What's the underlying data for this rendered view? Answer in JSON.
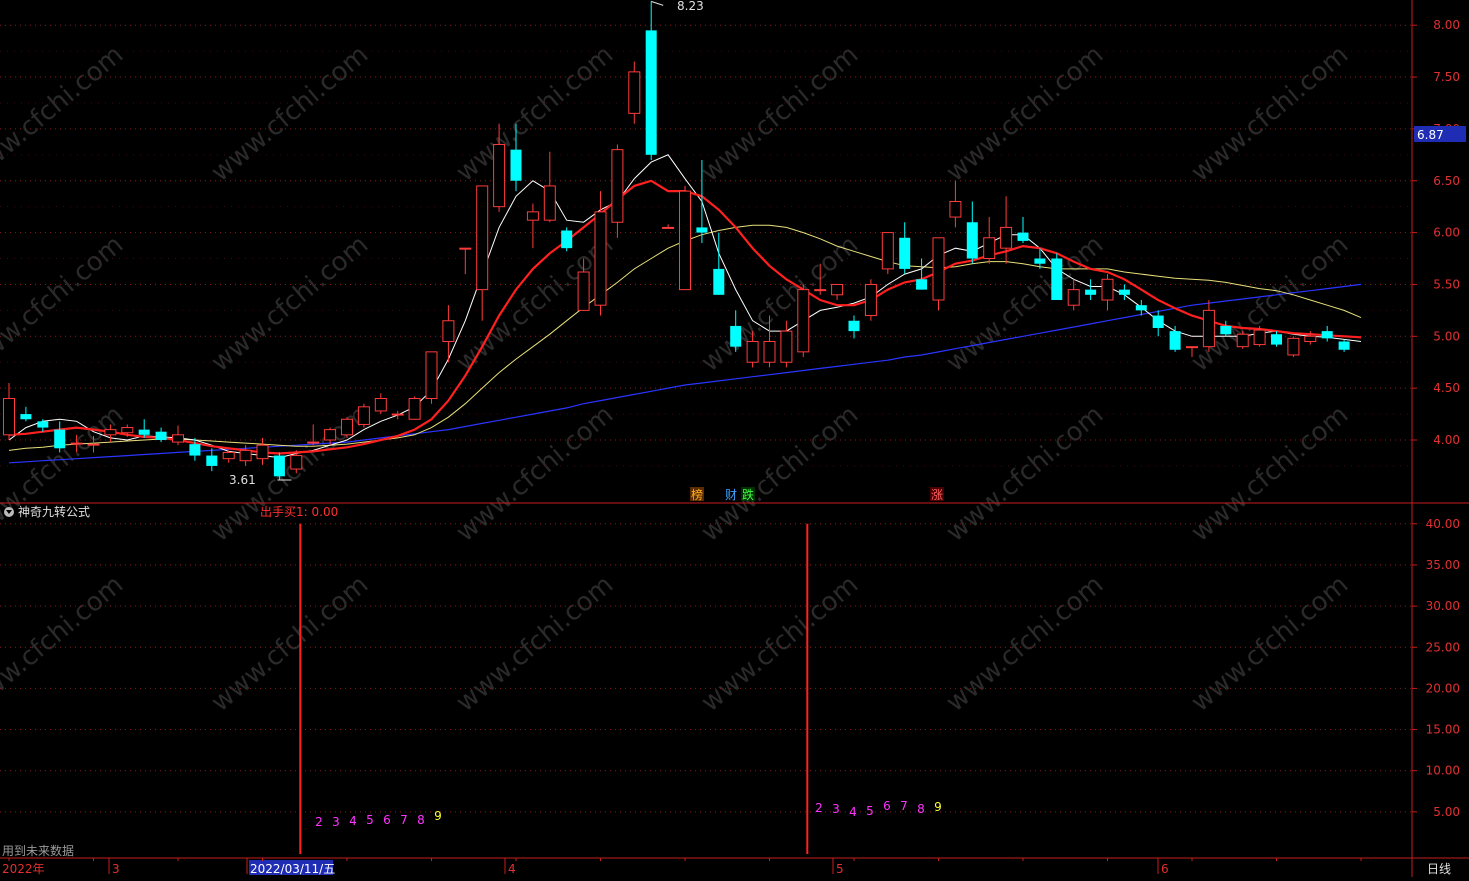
{
  "colors": {
    "background": "#000000",
    "up": "#ff3b3b",
    "down": "#00ffff",
    "grid": "#8b1a1a",
    "axis": "#c81e1e",
    "ma5": "#ffffff",
    "ma10": "#ff2020",
    "ma20": "#e8e07a",
    "ma60": "#2a35ff",
    "count": "#ff33ff",
    "count9": "#ffff33",
    "signal": "#ff2020",
    "last_price_bg": "#1e2db4"
  },
  "main_panel": {
    "y_ticks": [
      "8.00",
      "7.50",
      "7.00",
      "6.50",
      "6.00",
      "5.50",
      "5.00",
      "4.50",
      "4.00"
    ],
    "last_price": "6.87",
    "high_label": "8.23",
    "low_label": "3.61",
    "markers": [
      {
        "text": "榜",
        "color": "#ffb020",
        "bg": "#5a2a00"
      },
      {
        "text": "财",
        "color": "#40a0ff",
        "bg": "#000000"
      },
      {
        "text": "跌",
        "color": "#40ff40",
        "bg": "#003000"
      },
      {
        "text": "涨",
        "color": "#ff6060",
        "bg": "#4a0000"
      }
    ]
  },
  "indicator_panel": {
    "title": "神奇九转公式",
    "readout": "出手买1: 0.00",
    "y_ticks": [
      "40.00",
      "35.00",
      "30.00",
      "25.00",
      "20.00",
      "15.00",
      "10.00",
      "5.00"
    ],
    "footer_note": "用到未来数据",
    "count_sequences": [
      [
        "2",
        "3",
        "4",
        "5",
        "6",
        "7",
        "8",
        "9"
      ],
      [
        "2",
        "3",
        "4",
        "5",
        "6",
        "7",
        "8",
        "9"
      ]
    ]
  },
  "x_axis": {
    "labels": [
      "2022年",
      "3",
      "2022/03/11/五",
      "4",
      "5",
      "6"
    ],
    "period": "日线"
  },
  "watermark": "www.cfchi.com",
  "chart_data": {
    "type": "candlestick",
    "title": "",
    "ylim": [
      3.5,
      8.3
    ],
    "candles": [
      {
        "o": 4.05,
        "h": 4.55,
        "l": 4.0,
        "c": 4.4
      },
      {
        "o": 4.25,
        "h": 4.32,
        "l": 4.18,
        "c": 4.2
      },
      {
        "o": 4.18,
        "h": 4.2,
        "l": 4.08,
        "c": 4.12
      },
      {
        "o": 4.1,
        "h": 4.18,
        "l": 3.88,
        "c": 3.92
      },
      {
        "o": 3.97,
        "h": 4.05,
        "l": 3.88,
        "c": 3.97
      },
      {
        "o": 3.96,
        "h": 4.04,
        "l": 3.88,
        "c": 3.96
      },
      {
        "o": 4.05,
        "h": 4.15,
        "l": 3.98,
        "c": 4.1
      },
      {
        "o": 4.07,
        "h": 4.15,
        "l": 4.03,
        "c": 4.12
      },
      {
        "o": 4.1,
        "h": 4.2,
        "l": 4.02,
        "c": 4.05
      },
      {
        "o": 4.08,
        "h": 4.12,
        "l": 3.98,
        "c": 4.0
      },
      {
        "o": 3.98,
        "h": 4.14,
        "l": 3.95,
        "c": 4.05
      },
      {
        "o": 3.96,
        "h": 4.02,
        "l": 3.8,
        "c": 3.85
      },
      {
        "o": 3.85,
        "h": 3.92,
        "l": 3.7,
        "c": 3.75
      },
      {
        "o": 3.82,
        "h": 3.9,
        "l": 3.78,
        "c": 3.88
      },
      {
        "o": 3.8,
        "h": 3.95,
        "l": 3.75,
        "c": 3.9
      },
      {
        "o": 3.82,
        "h": 4.02,
        "l": 3.76,
        "c": 3.95
      },
      {
        "o": 3.85,
        "h": 3.88,
        "l": 3.61,
        "c": 3.65
      },
      {
        "o": 3.72,
        "h": 3.9,
        "l": 3.68,
        "c": 3.85
      },
      {
        "o": 3.98,
        "h": 4.15,
        "l": 3.95,
        "c": 3.98
      },
      {
        "o": 4.0,
        "h": 4.12,
        "l": 3.95,
        "c": 4.1
      },
      {
        "o": 4.05,
        "h": 4.22,
        "l": 4.02,
        "c": 4.2
      },
      {
        "o": 4.15,
        "h": 4.35,
        "l": 4.12,
        "c": 4.32
      },
      {
        "o": 4.28,
        "h": 4.45,
        "l": 4.25,
        "c": 4.4
      },
      {
        "o": 4.25,
        "h": 4.28,
        "l": 4.2,
        "c": 4.25
      },
      {
        "o": 4.2,
        "h": 4.42,
        "l": 4.2,
        "c": 4.4
      },
      {
        "o": 4.4,
        "h": 4.85,
        "l": 4.35,
        "c": 4.85
      },
      {
        "o": 4.95,
        "h": 5.3,
        "l": 4.75,
        "c": 5.15
      },
      {
        "o": 5.85,
        "h": 5.85,
        "l": 5.6,
        "c": 5.85
      },
      {
        "o": 5.45,
        "h": 6.45,
        "l": 5.15,
        "c": 6.45
      },
      {
        "o": 6.25,
        "h": 7.05,
        "l": 6.2,
        "c": 6.85
      },
      {
        "o": 6.8,
        "h": 7.05,
        "l": 6.4,
        "c": 6.5
      },
      {
        "o": 6.12,
        "h": 6.28,
        "l": 5.85,
        "c": 6.2
      },
      {
        "o": 6.12,
        "h": 6.78,
        "l": 6.1,
        "c": 6.45
      },
      {
        "o": 6.02,
        "h": 6.05,
        "l": 5.82,
        "c": 5.85
      },
      {
        "o": 5.25,
        "h": 5.75,
        "l": 5.25,
        "c": 5.62
      },
      {
        "o": 5.3,
        "h": 6.4,
        "l": 5.2,
        "c": 6.2
      },
      {
        "o": 6.1,
        "h": 6.85,
        "l": 5.95,
        "c": 6.8
      },
      {
        "o": 7.15,
        "h": 7.65,
        "l": 7.05,
        "c": 7.55
      },
      {
        "o": 7.95,
        "h": 8.23,
        "l": 6.7,
        "c": 6.75
      },
      {
        "o": 6.05,
        "h": 6.08,
        "l": 6.05,
        "c": 6.05
      },
      {
        "o": 5.45,
        "h": 6.45,
        "l": 5.45,
        "c": 6.4
      },
      {
        "o": 6.05,
        "h": 6.7,
        "l": 5.9,
        "c": 6.0
      },
      {
        "o": 5.65,
        "h": 6.0,
        "l": 5.4,
        "c": 5.4
      },
      {
        "o": 5.1,
        "h": 5.25,
        "l": 4.85,
        "c": 4.9
      },
      {
        "o": 4.75,
        "h": 5.05,
        "l": 4.7,
        "c": 4.95
      },
      {
        "o": 4.75,
        "h": 5.2,
        "l": 4.7,
        "c": 4.95
      },
      {
        "o": 4.75,
        "h": 5.15,
        "l": 4.7,
        "c": 5.05
      },
      {
        "o": 4.85,
        "h": 5.5,
        "l": 4.8,
        "c": 5.45
      },
      {
        "o": 5.45,
        "h": 5.7,
        "l": 5.4,
        "c": 5.45
      },
      {
        "o": 5.4,
        "h": 5.48,
        "l": 5.35,
        "c": 5.5
      },
      {
        "o": 5.15,
        "h": 5.2,
        "l": 4.98,
        "c": 5.05
      },
      {
        "o": 5.2,
        "h": 5.55,
        "l": 5.15,
        "c": 5.5
      },
      {
        "o": 5.65,
        "h": 6.0,
        "l": 5.6,
        "c": 6.0
      },
      {
        "o": 5.95,
        "h": 6.1,
        "l": 5.6,
        "c": 5.65
      },
      {
        "o": 5.55,
        "h": 5.75,
        "l": 5.45,
        "c": 5.45
      },
      {
        "o": 5.35,
        "h": 5.95,
        "l": 5.25,
        "c": 5.95
      },
      {
        "o": 6.15,
        "h": 6.5,
        "l": 6.05,
        "c": 6.3
      },
      {
        "o": 6.1,
        "h": 6.3,
        "l": 5.7,
        "c": 5.75
      },
      {
        "o": 5.75,
        "h": 6.15,
        "l": 5.7,
        "c": 5.95
      },
      {
        "o": 5.85,
        "h": 6.35,
        "l": 5.7,
        "c": 6.05
      },
      {
        "o": 6.0,
        "h": 6.15,
        "l": 5.9,
        "c": 5.92
      },
      {
        "o": 5.75,
        "h": 5.85,
        "l": 5.65,
        "c": 5.7
      },
      {
        "o": 5.75,
        "h": 5.8,
        "l": 5.35,
        "c": 5.35
      },
      {
        "o": 5.3,
        "h": 5.55,
        "l": 5.25,
        "c": 5.45
      },
      {
        "o": 5.45,
        "h": 5.55,
        "l": 5.35,
        "c": 5.4
      },
      {
        "o": 5.35,
        "h": 5.6,
        "l": 5.25,
        "c": 5.55
      },
      {
        "o": 5.45,
        "h": 5.5,
        "l": 5.35,
        "c": 5.4
      },
      {
        "o": 5.3,
        "h": 5.35,
        "l": 5.2,
        "c": 5.25
      },
      {
        "o": 5.2,
        "h": 5.25,
        "l": 5.0,
        "c": 5.08
      },
      {
        "o": 5.05,
        "h": 5.1,
        "l": 4.85,
        "c": 4.87
      },
      {
        "o": 4.9,
        "h": 4.9,
        "l": 4.8,
        "c": 4.9
      },
      {
        "o": 4.9,
        "h": 5.35,
        "l": 4.85,
        "c": 5.25
      },
      {
        "o": 5.1,
        "h": 5.15,
        "l": 5.0,
        "c": 5.02
      },
      {
        "o": 4.9,
        "h": 5.05,
        "l": 4.88,
        "c": 5.02
      },
      {
        "o": 4.92,
        "h": 5.1,
        "l": 4.9,
        "c": 5.06
      },
      {
        "o": 5.02,
        "h": 5.05,
        "l": 4.9,
        "c": 4.92
      },
      {
        "o": 4.82,
        "h": 5.0,
        "l": 4.8,
        "c": 4.98
      },
      {
        "o": 4.95,
        "h": 5.05,
        "l": 4.92,
        "c": 5.0
      },
      {
        "o": 5.05,
        "h": 5.1,
        "l": 4.95,
        "c": 4.98
      },
      {
        "o": 4.95,
        "h": 4.97,
        "l": 4.85,
        "c": 4.87
      }
    ],
    "ma": {
      "MA5": [
        4.0,
        4.12,
        4.18,
        4.2,
        4.18,
        4.08,
        4.02,
        4.0,
        4.04,
        4.03,
        4.02,
        4.0,
        3.95,
        3.89,
        3.87,
        3.85,
        3.83,
        3.87,
        3.9,
        3.95,
        4.0,
        4.1,
        4.18,
        4.24,
        4.32,
        4.48,
        4.78,
        5.15,
        5.6,
        6.05,
        6.35,
        6.5,
        6.4,
        6.12,
        6.1,
        6.22,
        6.3,
        6.52,
        6.68,
        6.75,
        6.52,
        6.3,
        5.8,
        5.45,
        5.15,
        5.05,
        5.05,
        5.15,
        5.25,
        5.28,
        5.32,
        5.38,
        5.5,
        5.6,
        5.65,
        5.78,
        5.85,
        5.82,
        5.9,
        5.98,
        5.98,
        5.85,
        5.65,
        5.55,
        5.48,
        5.48,
        5.4,
        5.28,
        5.15,
        5.05,
        5.0,
        5.0,
        5.0,
        5.0,
        5.03,
        5.05,
        5.02,
        5.0,
        4.99,
        4.97,
        4.95
      ],
      "MA10": [
        4.05,
        4.06,
        4.08,
        4.1,
        4.12,
        4.1,
        4.08,
        4.05,
        4.03,
        4.02,
        4.0,
        3.97,
        3.94,
        3.92,
        3.9,
        3.88,
        3.87,
        3.88,
        3.89,
        3.91,
        3.93,
        3.96,
        4.0,
        4.04,
        4.1,
        4.2,
        4.38,
        4.62,
        4.9,
        5.2,
        5.45,
        5.65,
        5.8,
        5.92,
        6.05,
        6.18,
        6.32,
        6.45,
        6.5,
        6.4,
        6.4,
        6.35,
        6.22,
        6.05,
        5.85,
        5.68,
        5.55,
        5.45,
        5.35,
        5.3,
        5.3,
        5.35,
        5.45,
        5.52,
        5.55,
        5.62,
        5.7,
        5.73,
        5.78,
        5.82,
        5.87,
        5.85,
        5.8,
        5.72,
        5.65,
        5.62,
        5.55,
        5.45,
        5.35,
        5.27,
        5.2,
        5.15,
        5.1,
        5.08,
        5.07,
        5.05,
        5.03,
        5.02,
        5.01,
        5.0,
        4.99
      ],
      "MA20": [
        3.9,
        3.92,
        3.93,
        3.95,
        3.96,
        3.97,
        3.98,
        3.99,
        4.0,
        4.01,
        4.01,
        4.0,
        3.99,
        3.98,
        3.97,
        3.96,
        3.95,
        3.94,
        3.94,
        3.95,
        3.96,
        3.98,
        4.0,
        4.02,
        4.05,
        4.12,
        4.22,
        4.35,
        4.5,
        4.65,
        4.78,
        4.9,
        5.02,
        5.15,
        5.28,
        5.4,
        5.52,
        5.65,
        5.75,
        5.85,
        5.92,
        5.98,
        6.02,
        6.05,
        6.07,
        6.07,
        6.05,
        6.0,
        5.94,
        5.87,
        5.82,
        5.77,
        5.72,
        5.68,
        5.67,
        5.66,
        5.67,
        5.7,
        5.72,
        5.72,
        5.7,
        5.67,
        5.65,
        5.65,
        5.65,
        5.65,
        5.62,
        5.6,
        5.58,
        5.56,
        5.55,
        5.54,
        5.52,
        5.49,
        5.46,
        5.44,
        5.4,
        5.35,
        5.3,
        5.25,
        5.18
      ],
      "MA60": [
        3.78,
        3.79,
        3.8,
        3.81,
        3.82,
        3.83,
        3.84,
        3.85,
        3.86,
        3.87,
        3.88,
        3.89,
        3.9,
        3.91,
        3.92,
        3.93,
        3.94,
        3.95,
        3.96,
        3.97,
        3.98,
        4.0,
        4.02,
        4.04,
        4.06,
        4.08,
        4.1,
        4.13,
        4.16,
        4.19,
        4.22,
        4.25,
        4.28,
        4.31,
        4.35,
        4.38,
        4.41,
        4.44,
        4.47,
        4.5,
        4.53,
        4.55,
        4.57,
        4.59,
        4.61,
        4.63,
        4.65,
        4.67,
        4.69,
        4.71,
        4.73,
        4.75,
        4.77,
        4.8,
        4.82,
        4.85,
        4.88,
        4.91,
        4.94,
        4.97,
        5.0,
        5.03,
        5.06,
        5.09,
        5.12,
        5.15,
        5.18,
        5.21,
        5.24,
        5.27,
        5.3,
        5.32,
        5.34,
        5.36,
        5.38,
        5.4,
        5.42,
        5.44,
        5.46,
        5.48,
        5.5
      ]
    },
    "indicator": {
      "type": "bar",
      "ylim": [
        0,
        42
      ],
      "signals": [
        {
          "index": 17,
          "value": 40
        },
        {
          "index": 47,
          "value": 40
        }
      ]
    }
  }
}
